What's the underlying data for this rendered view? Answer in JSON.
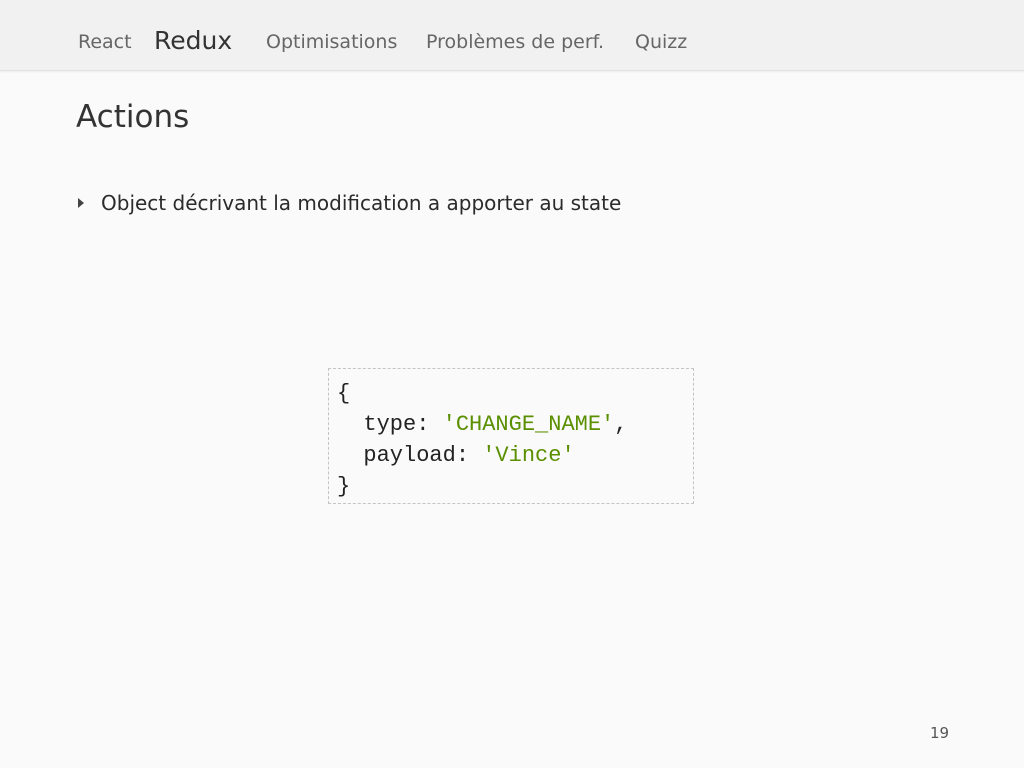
{
  "nav": {
    "items": [
      {
        "label": "React",
        "active": false
      },
      {
        "label": "Redux",
        "active": true
      },
      {
        "label": "Optimisations",
        "active": false
      },
      {
        "label": "Problèmes de perf.",
        "active": false
      },
      {
        "label": "Quizz",
        "active": false
      }
    ]
  },
  "slide": {
    "title": "Actions",
    "bullets": [
      "Object décrivant la modification a apporter au state"
    ],
    "code": {
      "open_brace": "{",
      "close_brace": "}",
      "lines": [
        {
          "key": "type",
          "value": "'CHANGE_NAME'",
          "trailing": ","
        },
        {
          "key": "payload",
          "value": "'Vince'",
          "trailing": ""
        }
      ]
    },
    "page_number": "19"
  },
  "colors": {
    "string_literal": "#5a8f00",
    "background": "#fafafa",
    "navbar_background": "#f1f1f1"
  },
  "icons": {
    "bullet": "triangle-bullet-icon"
  }
}
